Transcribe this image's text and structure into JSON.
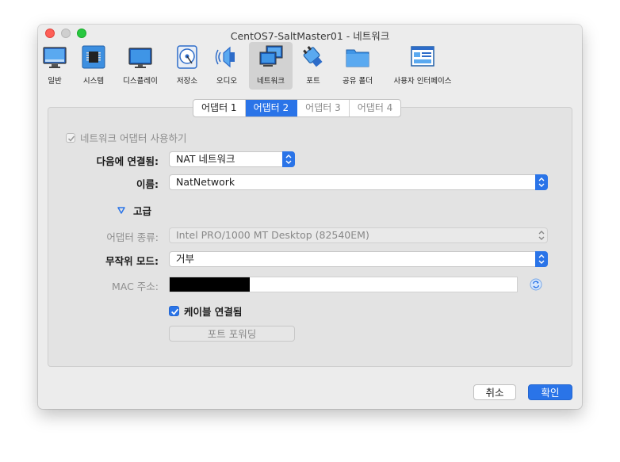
{
  "window": {
    "title": "CentOS7-SaltMaster01 - 네트워크"
  },
  "toolbar": {
    "items": [
      {
        "label": "일반",
        "icon": "general-icon"
      },
      {
        "label": "시스템",
        "icon": "system-icon"
      },
      {
        "label": "디스플레이",
        "icon": "display-icon"
      },
      {
        "label": "저장소",
        "icon": "storage-icon"
      },
      {
        "label": "오디오",
        "icon": "audio-icon"
      },
      {
        "label": "네트워크",
        "icon": "network-icon",
        "selected": true
      },
      {
        "label": "포트",
        "icon": "ports-icon"
      },
      {
        "label": "공유 폴더",
        "icon": "shared-folder-icon"
      },
      {
        "label": "사용자 인터페이스",
        "icon": "user-interface-icon"
      }
    ]
  },
  "tabs": {
    "items": [
      {
        "label": "어댑터 1"
      },
      {
        "label": "어댑터 2",
        "active": true
      },
      {
        "label": "어댑터 3"
      },
      {
        "label": "어댑터 4"
      }
    ]
  },
  "form": {
    "enable_adapter": {
      "label": "네트워크 어댑터 사용하기",
      "checked": true,
      "enabled": false
    },
    "attached_to": {
      "label": "다음에 연결됨:",
      "value": "NAT 네트워크"
    },
    "name": {
      "label": "이름:",
      "value": "NatNetwork"
    },
    "advanced": {
      "label": "고급"
    },
    "adapter_type": {
      "label": "어댑터 종류:",
      "value": "Intel PRO/1000 MT Desktop (82540EM)"
    },
    "promiscuous": {
      "label": "무작위 모드:",
      "value": "거부"
    },
    "mac": {
      "label": "MAC 주소:"
    },
    "cable": {
      "label": "케이블 연결됨",
      "checked": true
    },
    "port_forwarding": {
      "label": "포트 포워딩"
    }
  },
  "footer": {
    "cancel": "취소",
    "ok": "확인"
  },
  "colors": {
    "accent": "#2a74e8",
    "window_bg": "#ececec",
    "panel_bg": "#e3e3e3"
  }
}
